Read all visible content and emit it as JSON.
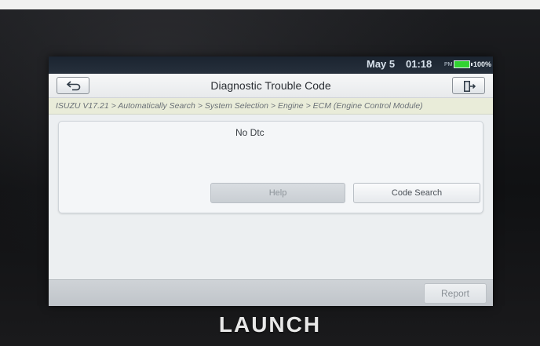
{
  "statusbar": {
    "date": "May 5",
    "time": "01:18",
    "ampm": "PM",
    "battery_percent": "100%",
    "battery_color": "#31d331"
  },
  "titlebar": {
    "title": "Diagnostic Trouble Code",
    "back_icon": "back-arrow-icon",
    "exit_icon": "exit-door-icon"
  },
  "breadcrumb": {
    "path": "ISUZU V17.21 > Automatically Search > System Selection > Engine > ECM (Engine Control Module)"
  },
  "result": {
    "message": "No Dtc"
  },
  "buttons": {
    "help": "Help",
    "code_search": "Code Search",
    "report": "Report"
  },
  "device": {
    "brand": "LAUNCH"
  }
}
